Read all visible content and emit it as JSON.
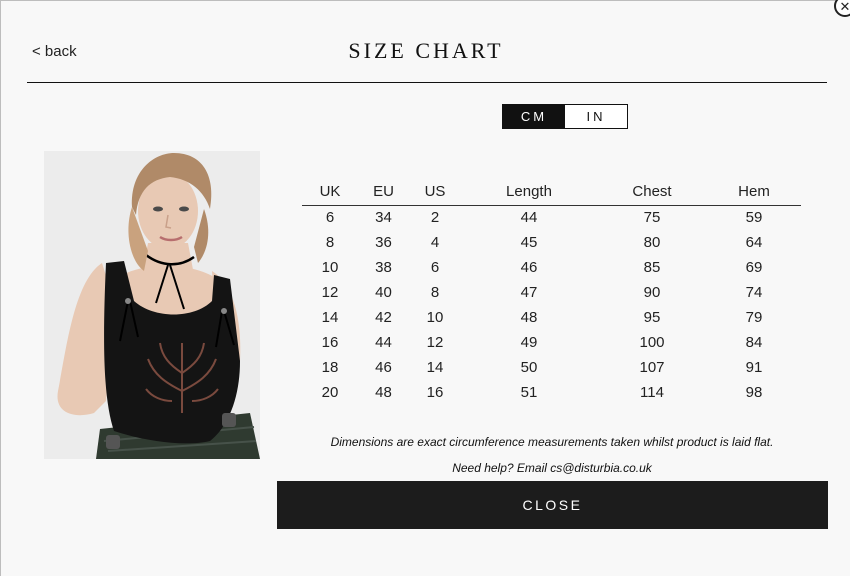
{
  "header": {
    "back_label": "< back",
    "title": "SIZE CHART",
    "close_glyph": "✕"
  },
  "unit_toggle": {
    "options": [
      "CM",
      "IN"
    ],
    "selected": "CM"
  },
  "product_image": {
    "subject": "model wearing black corset top with embroidered floral motif",
    "colors": {
      "background": "#ececec",
      "top": "#141414",
      "embroidery": "#7a4a3e",
      "skin": "#e8c9b4",
      "hair": "#b08a68",
      "skirt": "#2f3a30"
    }
  },
  "size_table": {
    "headers": [
      "UK",
      "EU",
      "US",
      "Length",
      "Chest",
      "Hem"
    ],
    "rows": [
      [
        "6",
        "34",
        "2",
        "44",
        "75",
        "59"
      ],
      [
        "8",
        "36",
        "4",
        "45",
        "80",
        "64"
      ],
      [
        "10",
        "38",
        "6",
        "46",
        "85",
        "69"
      ],
      [
        "12",
        "40",
        "8",
        "47",
        "90",
        "74"
      ],
      [
        "14",
        "42",
        "10",
        "48",
        "95",
        "79"
      ],
      [
        "16",
        "44",
        "12",
        "49",
        "100",
        "84"
      ],
      [
        "18",
        "46",
        "14",
        "50",
        "107",
        "91"
      ],
      [
        "20",
        "48",
        "16",
        "51",
        "114",
        "98"
      ]
    ]
  },
  "footer": {
    "note": "Dimensions are exact circumference measurements taken whilst product is laid flat.",
    "help": "Need help? Email cs@disturbia.co.uk",
    "close_label": "CLOSE"
  },
  "colors": {
    "modal_bg": "#f8f8f8",
    "active_toggle": "#111111",
    "close_button": "#1c1c1c"
  }
}
